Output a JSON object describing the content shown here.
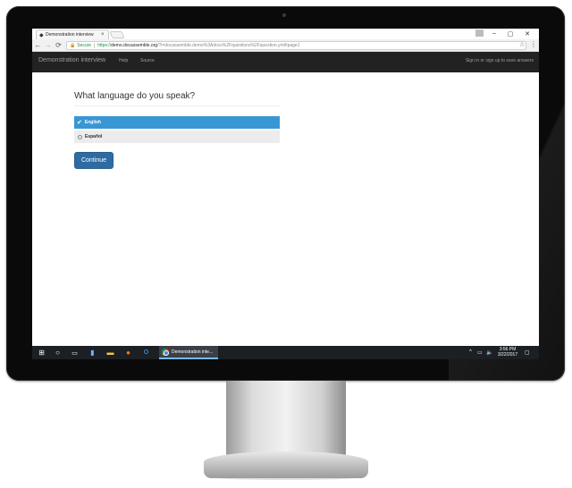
{
  "browser": {
    "tab_title": "Demonstration interview",
    "tab_close": "×",
    "window_minimize": "–",
    "window_maximize": "▢",
    "window_close": "✕",
    "secure_label": "Secure",
    "url_scheme": "https://",
    "url_host": "demo.docassemble.org",
    "url_rest": "/?i=docassemble.demo%3Adocs%2Fquestions%2Fquestion.yml#page1",
    "back_icon": "←",
    "forward_icon": "→",
    "reload_icon": "⟳",
    "star_icon": "☆",
    "menu_icon": "⋮"
  },
  "navbar": {
    "brand": "Demonstration interview",
    "links": [
      "Help",
      "Source"
    ],
    "signin": "Sign in or sign up to save answers"
  },
  "page": {
    "question": "What language do you speak?",
    "options": [
      {
        "label": "English",
        "selected": true
      },
      {
        "label": "Español",
        "selected": false
      }
    ],
    "continue_label": "Continue"
  },
  "taskbar": {
    "app_label": "Demonstration inte...",
    "time": "3:56 PM",
    "date": "3/22/2017"
  },
  "colors": {
    "navbar_bg": "#222222",
    "selected_option": "#3897d3",
    "continue_button": "#2d6ca2",
    "taskbar_bg": "#1c1f24"
  }
}
